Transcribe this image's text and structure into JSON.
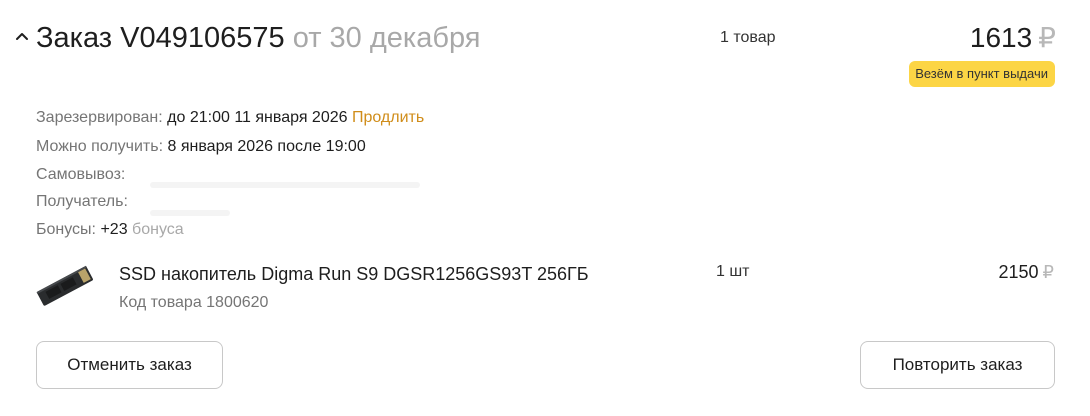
{
  "order": {
    "title_prefix": "Заказ",
    "number": "V049106575",
    "date_text": "от 30 декабря",
    "items_count": "1 товар",
    "total_value": "1613",
    "currency": "₽",
    "delivery_badge": "Везём в пункт выдачи"
  },
  "details": {
    "reserved": {
      "label": "Зарезервирован:",
      "value": "до 21:00 11 января 2026",
      "action": "Продлить"
    },
    "pickup_date": {
      "label": "Можно получить:",
      "value": "8 января 2026 после 19:00"
    },
    "pickup_point": {
      "label": "Самовывоз:"
    },
    "recipient": {
      "label": "Получатель:"
    },
    "bonuses": {
      "label": "Бонусы:",
      "value": "+23",
      "suffix": "бонуса"
    }
  },
  "item": {
    "name": "SSD накопитель Digma Run S9 DGSR1256GS93T 256ГБ",
    "code": "Код товара 1800620",
    "quantity": "1 шт",
    "price": "2150",
    "currency": "₽"
  },
  "buttons": {
    "cancel": "Отменить заказ",
    "repeat": "Повторить заказ"
  },
  "icons": {
    "collapse": "chevron-up-icon",
    "product": "ssd-product-image"
  },
  "colors": {
    "badge_bg": "#fcd545",
    "link": "#d08d1a",
    "muted": "#a8a8a8"
  }
}
